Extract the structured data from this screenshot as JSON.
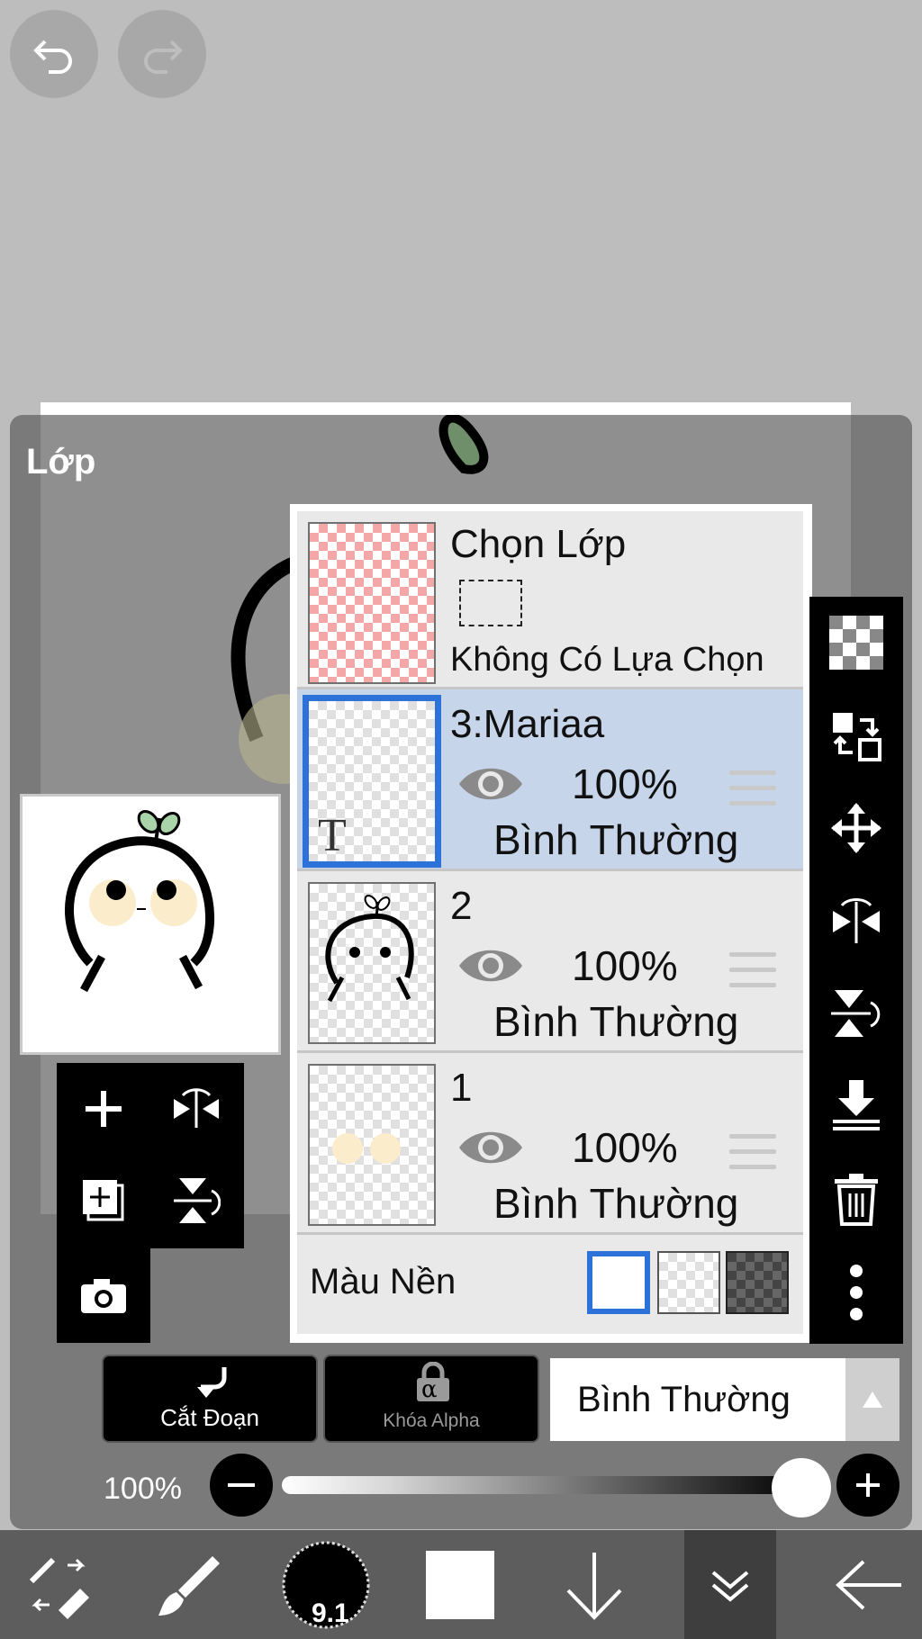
{
  "panel": {
    "title": "Lớp"
  },
  "selection_layer": {
    "title": "Chọn Lớp",
    "subtitle": "Không Có Lựa Chọn"
  },
  "layers": [
    {
      "name": "3:Mariaa",
      "opacity": "100%",
      "mode": "Bình Thường",
      "selected": true,
      "thumb_icon": "T"
    },
    {
      "name": "2",
      "opacity": "100%",
      "mode": "Bình Thường",
      "selected": false
    },
    {
      "name": "1",
      "opacity": "100%",
      "mode": "Bình Thường",
      "selected": false
    }
  ],
  "background": {
    "label": "Màu Nền"
  },
  "buttons": {
    "clipping": "Cắt Đoạn",
    "alpha_lock": "Khóa Alpha",
    "alpha_glyph": "α"
  },
  "blend_mode": {
    "value": "Bình Thường"
  },
  "opacity_control": {
    "label": "100%",
    "value": 1.0
  },
  "brush_size": "9.1",
  "colors": {
    "accent": "#2d72d9",
    "selected_row": "#c7d5ea",
    "pink_check": "#f3a7a7"
  }
}
